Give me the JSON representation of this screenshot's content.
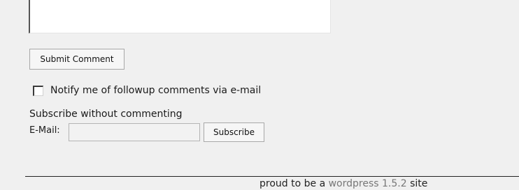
{
  "comment_form": {
    "comment_value": "",
    "submit_label": "Submit Comment",
    "notify_checked": false,
    "notify_label": "Notify me of followup comments via e-mail"
  },
  "subscribe": {
    "heading": "Subscribe without commenting",
    "email_label": "E-Mail:",
    "email_value": "",
    "button_label": "Subscribe"
  },
  "footer": {
    "prefix": "proud to be a ",
    "link_text": "wordpress 1.5.2",
    "suffix": " site"
  }
}
